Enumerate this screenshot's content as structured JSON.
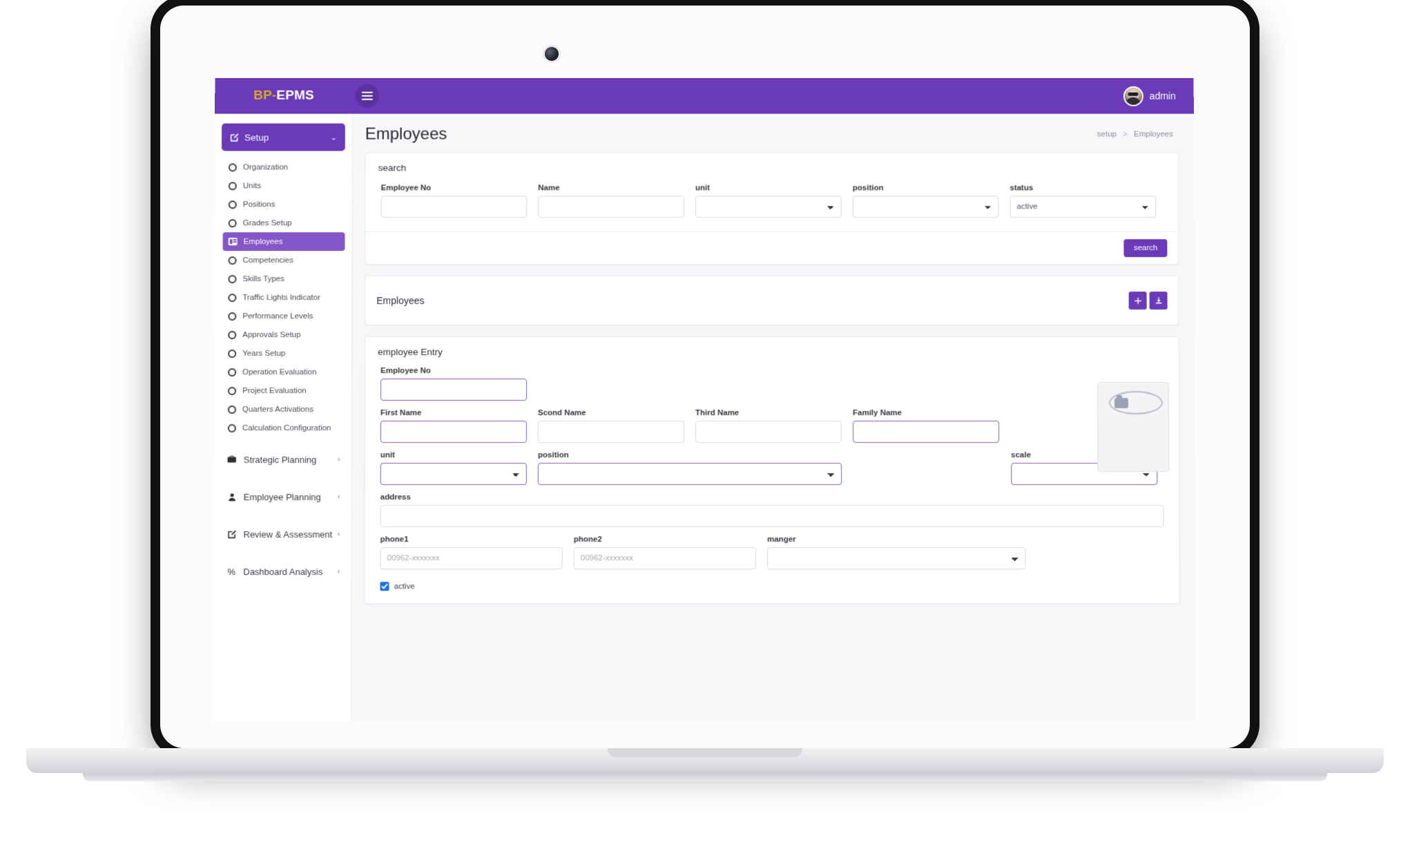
{
  "topbar": {
    "brand_first": "BP",
    "brand_sep": "-",
    "brand_second": "EPMS",
    "menu_toggle_label": "☰",
    "user_name": "admin"
  },
  "sidebar": {
    "group_setup": {
      "label": "Setup",
      "caret": "⌄",
      "items": [
        {
          "label": "Organization",
          "active": false
        },
        {
          "label": "Units",
          "active": false
        },
        {
          "label": "Positions",
          "active": false
        },
        {
          "label": "Grades Setup",
          "active": false
        },
        {
          "label": "Employees",
          "active": true
        },
        {
          "label": "Competencies",
          "active": false
        },
        {
          "label": "Skills Types",
          "active": false
        },
        {
          "label": "Traffic Lights Indicator",
          "active": false
        },
        {
          "label": "Performance Levels",
          "active": false
        },
        {
          "label": "Approvals Setup",
          "active": false
        },
        {
          "label": "Years Setup",
          "active": false
        },
        {
          "label": "Operation Evaluation",
          "active": false
        },
        {
          "label": "Project Evaluation",
          "active": false
        },
        {
          "label": "Quarters Activations",
          "active": false
        },
        {
          "label": "Calculation Configuration",
          "active": false
        }
      ]
    },
    "groups": [
      {
        "label": "Strategic Planning",
        "icon": "💼",
        "caret": "‹"
      },
      {
        "label": "Employee Planning",
        "icon": "👤",
        "caret": "‹"
      },
      {
        "label": "Review & Assessment",
        "icon": "✎",
        "caret": "‹"
      },
      {
        "label": "Dashboard Analysis",
        "icon": "%",
        "caret": "‹"
      }
    ]
  },
  "page": {
    "title": "Employees",
    "breadcrumb_parent": "setup",
    "breadcrumb_sep": ">",
    "breadcrumb_current": "Employees"
  },
  "search_card": {
    "title": "search",
    "fields": {
      "employee_no_label": "Employee No",
      "employee_no_value": "",
      "name_label": "Name",
      "name_value": "",
      "unit_label": "unit",
      "unit_value": "",
      "position_label": "position",
      "position_value": "",
      "status_label": "status",
      "status_value": "active"
    },
    "search_button": "search"
  },
  "list_panel": {
    "title": "Employees",
    "add_button": "➕",
    "export_button": "⬇"
  },
  "entry_card": {
    "title": "employee Entry",
    "fields": {
      "employee_no_label": "Employee No",
      "employee_no_value": "",
      "first_name_label": "First Name",
      "first_name_value": "",
      "second_name_label": "Scond Name",
      "second_name_value": "",
      "third_name_label": "Third Name",
      "third_name_value": "",
      "family_name_label": "Family Name",
      "family_name_value": "",
      "unit_label": "unit",
      "unit_value": "",
      "position_label": "position",
      "position_value": "",
      "scale_label": "scale",
      "scale_value": "",
      "address_label": "address",
      "address_value": "",
      "phone1_label": "phone1",
      "phone1_placeholder": "00962-xxxxxxx",
      "phone2_label": "phone2",
      "phone2_placeholder": "00962-xxxxxxx",
      "manager_label": "manger",
      "manager_value": "",
      "active_label": "active"
    }
  },
  "colors": {
    "brand_purple": "#6a3ab8",
    "brand_gold": "#d8a92b",
    "accent_border": "#8457c9",
    "checkbox_blue": "#1a73e8"
  }
}
